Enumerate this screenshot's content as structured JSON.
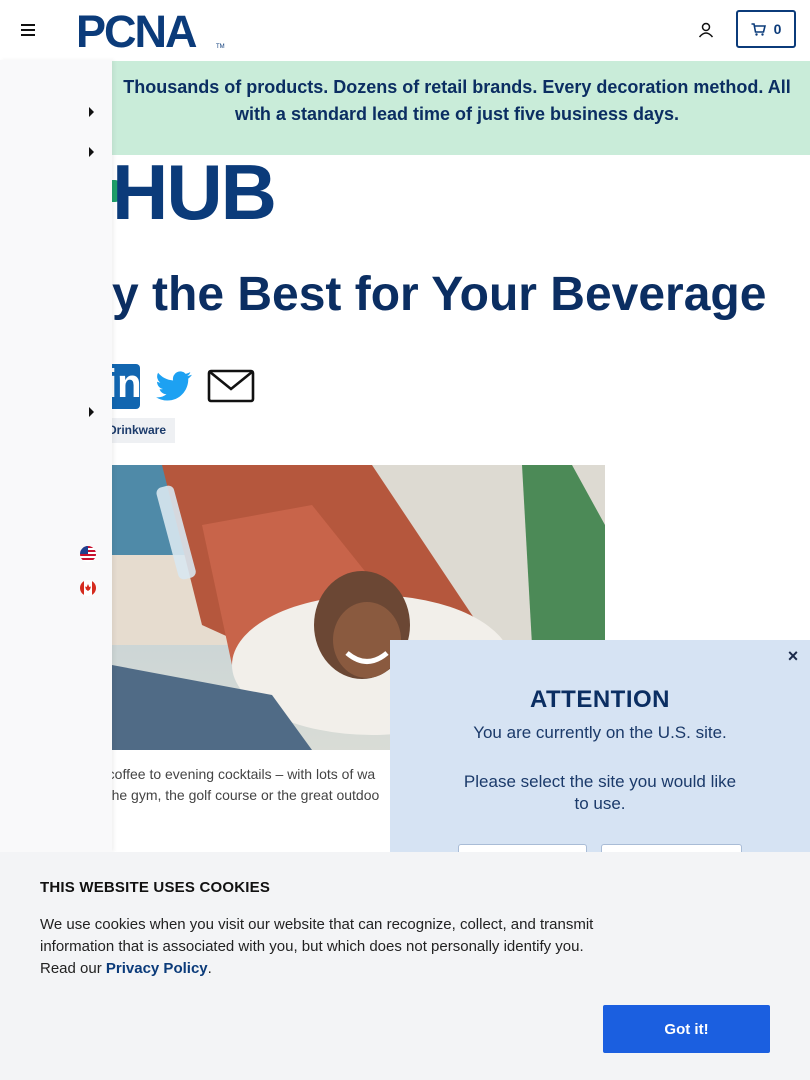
{
  "header": {
    "logo_text": "PCNA",
    "logo_tm": "TM",
    "cart_count": "0"
  },
  "banner": {
    "text": "Thousands of products. Dozens of retail brands. Every decoration method. All with a standard lead time of just five business days."
  },
  "hub": {
    "logo_text": "HUB"
  },
  "article": {
    "title": "y the Best for Your Beverage",
    "tag": "Drinkware",
    "caption_line1": "g coffee to evening cocktails – with lots of wa",
    "caption_line2": "g the gym, the golf course or the great outdoo"
  },
  "share": {
    "linkedin": "in"
  },
  "modal": {
    "close": "×",
    "title": "ATTENTION",
    "line1": "You are currently on the U.S. site.",
    "line2": "Please select the site you would like to use."
  },
  "cookie": {
    "title": "THIS WEBSITE USES COOKIES",
    "text": "We use cookies when you visit our website that can recognize, collect, and transmit information that is associated with you, but which does not personally identify you. Read our",
    "link": "Privacy Policy",
    "period": ".",
    "button": "Got it!"
  },
  "colors": {
    "brand_navy": "#0b3b7a",
    "banner_green": "#c9ecd9",
    "modal_blue": "#d6e3f3",
    "cookie_button": "#1b5fe0"
  },
  "icons": [
    "menu-icon",
    "account-icon",
    "cart-icon",
    "twitter-icon",
    "mail-icon",
    "linkedin-icon",
    "us-flag-icon",
    "canada-flag-icon",
    "close-icon"
  ]
}
